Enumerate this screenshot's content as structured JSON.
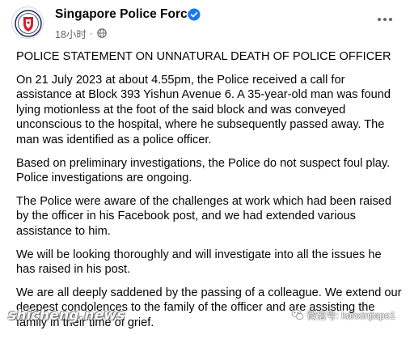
{
  "post": {
    "page_name": "Singapore Police Force",
    "timestamp": "18小时",
    "separator": "·",
    "paragraphs": [
      "POLICE STATEMENT ON UNNATURAL DEATH OF POLICE OFFICER",
      "On 21 July 2023 at about 4.55pm, the Police received a call for assistance at Block 393 Yishun Avenue 6. A 35-year-old man was found lying motionless at the foot of the said block and was conveyed unconscious to the hospital, where he subsequently passed away. The man was identified as a police officer.",
      "Based on preliminary investigations, the Police do not suspect foul play. Police investigations are ongoing.",
      "The Police were aware of the challenges at work which had been raised by the officer in his Facebook post, and we had extended various assistance to him.",
      "We will be looking thoroughly and will investigate into all the issues he has raised in his post.",
      "We are all deeply saddened by the passing of a colleague. We extend our deepest condolences to the family of the officer and are assisting the family in their time of grief."
    ]
  },
  "watermarks": {
    "wechat": "微信号: kanxinjiapo1",
    "site": "shicheng.news"
  },
  "colors": {
    "verified_blue": "#1877f2",
    "meta_gray": "#65676b",
    "police_red": "#d0202e",
    "police_navy": "#1d2c5e"
  },
  "icons": [
    "police-crest-icon",
    "verified-badge-icon",
    "globe-icon",
    "more-options-icon",
    "wechat-icon"
  ]
}
